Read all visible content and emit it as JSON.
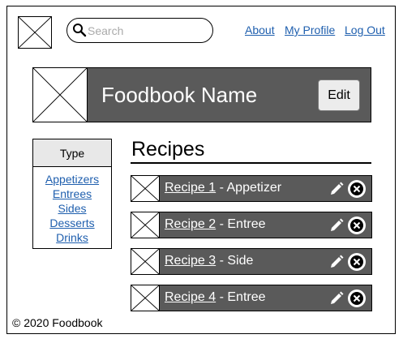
{
  "header": {
    "logo_icon": "image-placeholder-icon",
    "search": {
      "placeholder": "Search",
      "value": ""
    },
    "nav": [
      {
        "label": "About"
      },
      {
        "label": "My Profile"
      },
      {
        "label": "Log Out"
      }
    ]
  },
  "banner": {
    "image_icon": "image-placeholder-icon",
    "title": "Foodbook Name",
    "edit_label": "Edit",
    "background": "#5a5a5a"
  },
  "type_filter": {
    "heading": "Type",
    "items": [
      {
        "label": "Appetizers"
      },
      {
        "label": "Entrees"
      },
      {
        "label": "Sides"
      },
      {
        "label": "Desserts"
      },
      {
        "label": "Drinks"
      }
    ]
  },
  "recipes": {
    "heading": "Recipes",
    "items": [
      {
        "name": "Recipe 1",
        "category": " - Appetizer"
      },
      {
        "name": "Recipe 2",
        "category": " - Entree"
      },
      {
        "name": "Recipe 3",
        "category": " - Side"
      },
      {
        "name": "Recipe 4",
        "category": " - Entree"
      }
    ],
    "row_icons": [
      "pencil-icon",
      "close-icon"
    ]
  },
  "footer": {
    "text": "© 2020 Foodbook"
  },
  "colors": {
    "link": "#1f5fae",
    "dark_panel": "#5a5a5a",
    "header_cell": "#e8e8e8"
  }
}
